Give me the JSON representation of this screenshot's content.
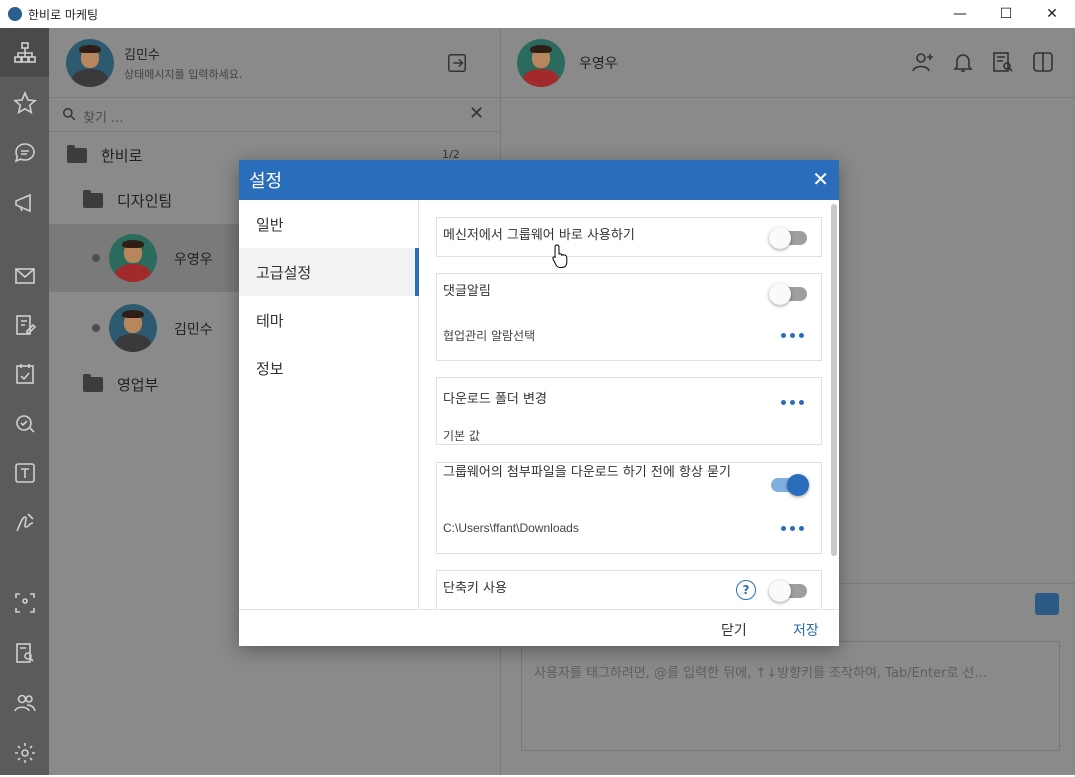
{
  "window": {
    "title": "한비로 마케팅",
    "minimize": "—",
    "maximize": "☐",
    "close": "✕"
  },
  "me": {
    "name": "김민수",
    "status_placeholder": "상태메시지를 입력하세요."
  },
  "search": {
    "placeholder": "찾기 ..."
  },
  "tree": {
    "root": "한비로",
    "pager": "1/2",
    "team": "디자인팀",
    "contacts": [
      "우영우",
      "김민수"
    ],
    "other_dept": "영업부"
  },
  "chat": {
    "name": "우영우",
    "input_placeholder": "사용자를 태그하려면, @를 입력한 뒤에, ↑↓방향키를 조작하여, Tab/Enter로 선..."
  },
  "modal": {
    "title": "설정",
    "close": "✕",
    "tabs": [
      "일반",
      "고급설정",
      "테마",
      "정보"
    ],
    "active_tab": 1,
    "settings": {
      "groupware": {
        "label": "메신저에서 그룹웨어 바로 사용하기",
        "on": false
      },
      "comment_alarm": {
        "label": "댓글알림",
        "on": false,
        "sub": "협업관리 알람선택"
      },
      "download_folder": {
        "label": "다운로드 폴더 변경",
        "sub": "기본 값"
      },
      "ask_before_download": {
        "label": "그룹웨어의 첨부파일을 다운로드 하기 전에 항상 묻기",
        "on": true,
        "sub": "C:\\Users\\ffant\\Downloads"
      },
      "shortcut": {
        "label": "단축키 사용",
        "on": false,
        "help": "?"
      }
    },
    "footer": {
      "close": "닫기",
      "save": "저장"
    }
  },
  "colors": {
    "accent": "#2a6ebb",
    "nav_bg": "#5b5b5b"
  }
}
